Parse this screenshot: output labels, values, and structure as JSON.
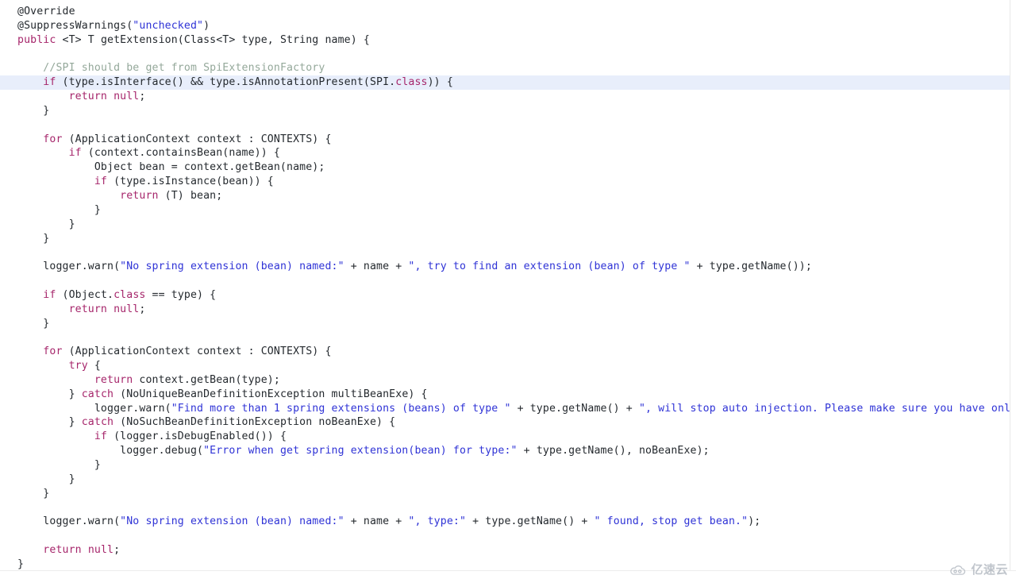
{
  "editor": {
    "language": "java",
    "background": "#ffffff",
    "highlight_line_color": "#e8eefb",
    "colors": {
      "keyword": "#a6266b",
      "string": "#2f33d6",
      "comment": "#94a89a",
      "plain": "#24292e"
    },
    "highlighted_line_index": 5
  },
  "watermark": {
    "text": "亿速云",
    "logo_icon": "cloud-icon"
  },
  "code": {
    "lines": [
      {
        "indent": 0,
        "tokens": [
          {
            "t": "ann",
            "v": "@Override"
          }
        ]
      },
      {
        "indent": 0,
        "tokens": [
          {
            "t": "ann",
            "v": "@SuppressWarnings("
          },
          {
            "t": "str",
            "v": "\"unchecked\""
          },
          {
            "t": "pln",
            "v": ")"
          }
        ]
      },
      {
        "indent": 0,
        "tokens": [
          {
            "t": "kw",
            "v": "public"
          },
          {
            "t": "pln",
            "v": " <T> T getExtension(Class<T> type, String name) {"
          }
        ]
      },
      {
        "indent": 0,
        "tokens": []
      },
      {
        "indent": 1,
        "tokens": [
          {
            "t": "cmt",
            "v": "//SPI should be get from SpiExtensionFactory"
          }
        ]
      },
      {
        "indent": 1,
        "tokens": [
          {
            "t": "kw",
            "v": "if"
          },
          {
            "t": "pln",
            "v": " (type.isInterface() && type.isAnnotationPresent(SPI."
          },
          {
            "t": "kw",
            "v": "class"
          },
          {
            "t": "pln",
            "v": ")) {"
          }
        ]
      },
      {
        "indent": 2,
        "tokens": [
          {
            "t": "kw",
            "v": "return"
          },
          {
            "t": "pln",
            "v": " "
          },
          {
            "t": "kw",
            "v": "null"
          },
          {
            "t": "pln",
            "v": ";"
          }
        ]
      },
      {
        "indent": 1,
        "tokens": [
          {
            "t": "pln",
            "v": "}"
          }
        ]
      },
      {
        "indent": 0,
        "tokens": []
      },
      {
        "indent": 1,
        "tokens": [
          {
            "t": "kw",
            "v": "for"
          },
          {
            "t": "pln",
            "v": " (ApplicationContext context : CONTEXTS) {"
          }
        ]
      },
      {
        "indent": 2,
        "tokens": [
          {
            "t": "kw",
            "v": "if"
          },
          {
            "t": "pln",
            "v": " (context.containsBean(name)) {"
          }
        ]
      },
      {
        "indent": 3,
        "tokens": [
          {
            "t": "pln",
            "v": "Object bean = context.getBean(name);"
          }
        ]
      },
      {
        "indent": 3,
        "tokens": [
          {
            "t": "kw",
            "v": "if"
          },
          {
            "t": "pln",
            "v": " (type.isInstance(bean)) {"
          }
        ]
      },
      {
        "indent": 4,
        "tokens": [
          {
            "t": "kw",
            "v": "return"
          },
          {
            "t": "pln",
            "v": " (T) bean;"
          }
        ]
      },
      {
        "indent": 3,
        "tokens": [
          {
            "t": "pln",
            "v": "}"
          }
        ]
      },
      {
        "indent": 2,
        "tokens": [
          {
            "t": "pln",
            "v": "}"
          }
        ]
      },
      {
        "indent": 1,
        "tokens": [
          {
            "t": "pln",
            "v": "}"
          }
        ]
      },
      {
        "indent": 0,
        "tokens": []
      },
      {
        "indent": 1,
        "tokens": [
          {
            "t": "pln",
            "v": "logger.warn("
          },
          {
            "t": "str",
            "v": "\"No spring extension (bean) named:\""
          },
          {
            "t": "pln",
            "v": " + name + "
          },
          {
            "t": "str",
            "v": "\", try to find an extension (bean) of type \""
          },
          {
            "t": "pln",
            "v": " + type.getName());"
          }
        ]
      },
      {
        "indent": 0,
        "tokens": []
      },
      {
        "indent": 1,
        "tokens": [
          {
            "t": "kw",
            "v": "if"
          },
          {
            "t": "pln",
            "v": " (Object."
          },
          {
            "t": "kw",
            "v": "class"
          },
          {
            "t": "pln",
            "v": " == type) {"
          }
        ]
      },
      {
        "indent": 2,
        "tokens": [
          {
            "t": "kw",
            "v": "return"
          },
          {
            "t": "pln",
            "v": " "
          },
          {
            "t": "kw",
            "v": "null"
          },
          {
            "t": "pln",
            "v": ";"
          }
        ]
      },
      {
        "indent": 1,
        "tokens": [
          {
            "t": "pln",
            "v": "}"
          }
        ]
      },
      {
        "indent": 0,
        "tokens": []
      },
      {
        "indent": 1,
        "tokens": [
          {
            "t": "kw",
            "v": "for"
          },
          {
            "t": "pln",
            "v": " (ApplicationContext context : CONTEXTS) {"
          }
        ]
      },
      {
        "indent": 2,
        "tokens": [
          {
            "t": "kw",
            "v": "try"
          },
          {
            "t": "pln",
            "v": " {"
          }
        ]
      },
      {
        "indent": 3,
        "tokens": [
          {
            "t": "kw",
            "v": "return"
          },
          {
            "t": "pln",
            "v": " context.getBean(type);"
          }
        ]
      },
      {
        "indent": 2,
        "tokens": [
          {
            "t": "pln",
            "v": "} "
          },
          {
            "t": "kw",
            "v": "catch"
          },
          {
            "t": "pln",
            "v": " (NoUniqueBeanDefinitionException multiBeanExe) {"
          }
        ]
      },
      {
        "indent": 3,
        "tokens": [
          {
            "t": "pln",
            "v": "logger.warn("
          },
          {
            "t": "str",
            "v": "\"Find more than 1 spring extensions (beans) of type \""
          },
          {
            "t": "pln",
            "v": " + type.getName() + "
          },
          {
            "t": "str",
            "v": "\", will stop auto injection. Please make sure you have only one speciafied ex"
          }
        ]
      },
      {
        "indent": 2,
        "tokens": [
          {
            "t": "pln",
            "v": "} "
          },
          {
            "t": "kw",
            "v": "catch"
          },
          {
            "t": "pln",
            "v": " (NoSuchBeanDefinitionException noBeanExe) {"
          }
        ]
      },
      {
        "indent": 3,
        "tokens": [
          {
            "t": "kw",
            "v": "if"
          },
          {
            "t": "pln",
            "v": " (logger.isDebugEnabled()) {"
          }
        ]
      },
      {
        "indent": 4,
        "tokens": [
          {
            "t": "pln",
            "v": "logger.debug("
          },
          {
            "t": "str",
            "v": "\"Error when get spring extension(bean) for type:\""
          },
          {
            "t": "pln",
            "v": " + type.getName(), noBeanExe);"
          }
        ]
      },
      {
        "indent": 3,
        "tokens": [
          {
            "t": "pln",
            "v": "}"
          }
        ]
      },
      {
        "indent": 2,
        "tokens": [
          {
            "t": "pln",
            "v": "}"
          }
        ]
      },
      {
        "indent": 1,
        "tokens": [
          {
            "t": "pln",
            "v": "}"
          }
        ]
      },
      {
        "indent": 0,
        "tokens": []
      },
      {
        "indent": 1,
        "tokens": [
          {
            "t": "pln",
            "v": "logger.warn("
          },
          {
            "t": "str",
            "v": "\"No spring extension (bean) named:\""
          },
          {
            "t": "pln",
            "v": " + name + "
          },
          {
            "t": "str",
            "v": "\", type:\""
          },
          {
            "t": "pln",
            "v": " + type.getName() + "
          },
          {
            "t": "str",
            "v": "\" found, stop get bean.\""
          },
          {
            "t": "pln",
            "v": ");"
          }
        ]
      },
      {
        "indent": 0,
        "tokens": []
      },
      {
        "indent": 1,
        "tokens": [
          {
            "t": "kw",
            "v": "return"
          },
          {
            "t": "pln",
            "v": " "
          },
          {
            "t": "kw",
            "v": "null"
          },
          {
            "t": "pln",
            "v": ";"
          }
        ]
      },
      {
        "indent": 0,
        "tokens": [
          {
            "t": "pln",
            "v": "}"
          }
        ]
      }
    ]
  }
}
